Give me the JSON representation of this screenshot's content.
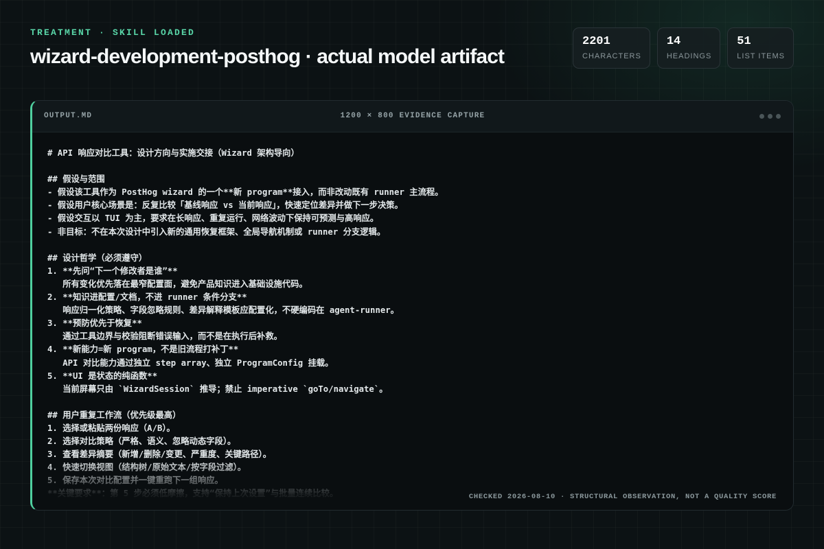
{
  "header": {
    "eyebrow": "TREATMENT · SKILL LOADED",
    "title": "wizard-development-posthog · actual model artifact"
  },
  "stats": [
    {
      "value": "2201",
      "label": "CHARACTERS"
    },
    {
      "value": "14",
      "label": "HEADINGS"
    },
    {
      "value": "51",
      "label": "LIST ITEMS"
    }
  ],
  "card": {
    "file_name": "OUTPUT.MD",
    "capture_label": "1200 × 800 EVIDENCE CAPTURE",
    "footer_note": "CHECKED 2026-08-10 · STRUCTURAL OBSERVATION, NOT A QUALITY SCORE",
    "accent_color": "#4fcf9f",
    "content": "# API 响应对比工具：设计方向与实施交接（Wizard 架构导向）\n\n## 假设与范围\n- 假设该工具作为 PostHog wizard 的一个**新 program**接入，而非改动既有 runner 主流程。\n- 假设用户核心场景是：反复比较「基线响应 vs 当前响应」，快速定位差异并做下一步决策。\n- 假设交互以 TUI 为主，要求在长响应、重复运行、网络波动下保持可预测与高响应。\n- 非目标：不在本次设计中引入新的通用恢复框架、全局导航机制或 runner 分支逻辑。\n\n## 设计哲学（必须遵守）\n1. **先问“下一个修改者是谁”**\n   所有变化优先落在最窄配置面，避免产品知识进入基础设施代码。\n2. **知识进配置/文档，不进 runner 条件分支**\n   响应归一化策略、字段忽略规则、差异解释模板应配置化，不硬编码在 agent-runner。\n3. **预防优先于恢复**\n   通过工具边界与校验阻断错误输入，而不是在执行后补救。\n4. **新能力=新 program，不是旧流程打补丁**\n   API 对比能力通过独立 step array、独立 ProgramConfig 挂载。\n5. **UI 是状态的纯函数**\n   当前屏幕只由 `WizardSession` 推导；禁止 imperative `goTo/navigate`。\n\n## 用户重复工作流（优先级最高）\n1. 选择或粘贴两份响应（A/B）。\n2. 选择对比策略（严格、语义、忽略动态字段）。\n3. 查看差异摘要（新增/删除/变更、严重度、关键路径）。\n4. 快速切换视图（结构树/原始文本/按字段过滤）。\n5. 保存本次对比配置并一键重跑下一组响应。\n**关键要求**：第 5 步必须低摩擦，支持“保持上次设置”与批量连续比较。"
  }
}
